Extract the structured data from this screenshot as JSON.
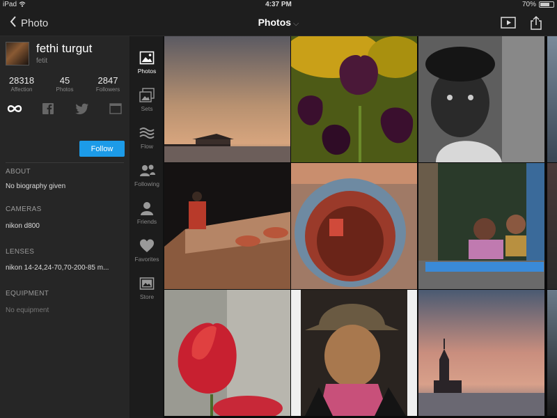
{
  "status_bar": {
    "device": "iPad",
    "time": "4:37 PM",
    "battery": "70%",
    "battery_level": 0.7
  },
  "nav": {
    "back_label": "Photo",
    "title": "Photos",
    "play_icon": "play-icon",
    "share_icon": "share-icon"
  },
  "profile": {
    "name": "fethi turgut",
    "username": "fetit",
    "stats": [
      {
        "value": "28318",
        "label": "Affection"
      },
      {
        "value": "45",
        "label": "Photos"
      },
      {
        "value": "2847",
        "label": "Followers"
      }
    ],
    "socials": [
      "infinity-icon",
      "facebook-icon",
      "twitter-icon",
      "website-icon"
    ],
    "follow_label": "Follow",
    "sections": [
      {
        "heading": "ABOUT",
        "value": "No biography given",
        "muted": false
      },
      {
        "heading": "CAMERAS",
        "value": "nikon d800",
        "muted": false
      },
      {
        "heading": "LENSES",
        "value": "nikon 14-24,24-70,70-200-85 m...",
        "muted": false
      },
      {
        "heading": "EQUIPMENT",
        "value": "No equipment",
        "muted": true
      }
    ]
  },
  "tabs": [
    {
      "label": "Photos",
      "icon": "photo-icon",
      "active": true
    },
    {
      "label": "Sets",
      "icon": "sets-icon",
      "active": false
    },
    {
      "label": "Flow",
      "icon": "flow-icon",
      "active": false
    },
    {
      "label": "Following",
      "icon": "following-icon",
      "active": false
    },
    {
      "label": "Friends",
      "icon": "friends-icon",
      "active": false
    },
    {
      "label": "Favorites",
      "icon": "heart-icon",
      "active": false
    },
    {
      "label": "Store",
      "icon": "store-icon",
      "active": false
    }
  ],
  "photos": [
    {
      "subject": "pier-sunset"
    },
    {
      "subject": "purple-tulips"
    },
    {
      "subject": "girl-portrait-bw"
    },
    {
      "subject": "pottery-kiln-worker"
    },
    {
      "subject": "clay-pots-well"
    },
    {
      "subject": "children-window"
    },
    {
      "subject": "red-tulip"
    },
    {
      "subject": "man-hat-portrait"
    },
    {
      "subject": "maiden-tower-sunset"
    }
  ],
  "colors": {
    "accent": "#1c9be8",
    "panel": "#262626",
    "rail": "#1c1c1c",
    "bar": "#1e1e1e"
  }
}
